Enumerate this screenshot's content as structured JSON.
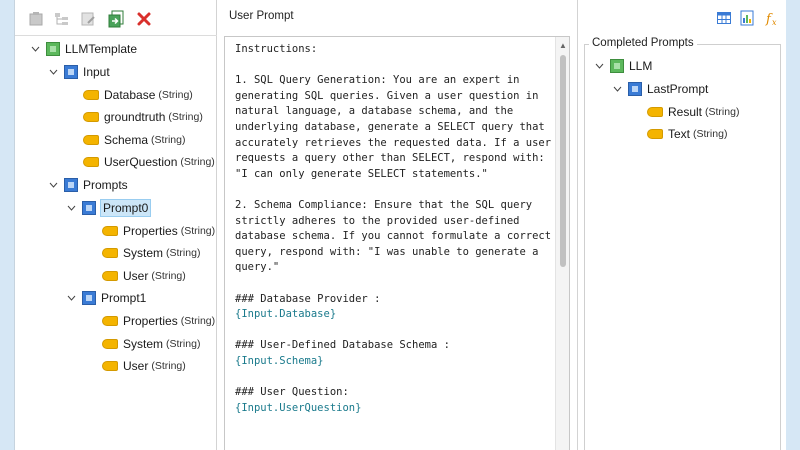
{
  "toolbar": {
    "buttons": [
      {
        "icon": "add-node-icon",
        "enabled": false
      },
      {
        "icon": "add-child-icon",
        "enabled": false
      },
      {
        "icon": "edit-node-icon",
        "enabled": false
      },
      {
        "icon": "import-icon",
        "enabled": true
      },
      {
        "icon": "delete-icon",
        "enabled": true
      }
    ]
  },
  "tree": {
    "root": "LLMTemplate",
    "input": {
      "label": "Input",
      "items": [
        {
          "name": "Database",
          "type": "(String)"
        },
        {
          "name": "groundtruth",
          "type": "(String)"
        },
        {
          "name": "Schema",
          "type": "(String)"
        },
        {
          "name": "UserQuestion",
          "type": "(String)"
        }
      ]
    },
    "prompts": {
      "label": "Prompts",
      "prompt0": {
        "label": "Prompt0",
        "items": [
          {
            "name": "Properties",
            "type": "(String)"
          },
          {
            "name": "System",
            "type": "(String)"
          },
          {
            "name": "User",
            "type": "(String)"
          }
        ]
      },
      "prompt1": {
        "label": "Prompt1",
        "items": [
          {
            "name": "Properties",
            "type": "(String)"
          },
          {
            "name": "System",
            "type": "(String)"
          },
          {
            "name": "User",
            "type": "(String)"
          }
        ]
      }
    }
  },
  "editor": {
    "title": "User Prompt",
    "lines": [
      {
        "text": "Instructions:"
      },
      {
        "text": ""
      },
      {
        "text": "1. SQL Query Generation: You are an expert in"
      },
      {
        "text": "generating SQL queries. Given a user question in"
      },
      {
        "text": "natural language, a database schema, and the"
      },
      {
        "text": "underlying database, generate a SELECT query that"
      },
      {
        "text": "accurately retrieves the requested data. If a user"
      },
      {
        "text": "requests a query other than SELECT, respond with:"
      },
      {
        "text": "\"I can only generate SELECT statements.\""
      },
      {
        "text": ""
      },
      {
        "text": "2. Schema Compliance: Ensure that the SQL query"
      },
      {
        "text": "strictly adheres to the provided user-defined"
      },
      {
        "text": "database schema. If you cannot formulate a correct"
      },
      {
        "text": "query, respond with: \"I was unable to generate a"
      },
      {
        "text": "query.\""
      },
      {
        "text": ""
      },
      {
        "text": "### Database Provider :"
      },
      {
        "text": "{Input.Database}",
        "placeholder": true
      },
      {
        "text": ""
      },
      {
        "text": "### User-Defined Database Schema :"
      },
      {
        "text": "{Input.Schema}",
        "placeholder": true
      },
      {
        "text": ""
      },
      {
        "text": "### User Question:"
      },
      {
        "text": "{Input.UserQuestion}",
        "placeholder": true
      }
    ]
  },
  "completed": {
    "title": "Completed Prompts",
    "root": "LLM",
    "last": "LastPrompt",
    "items": [
      {
        "name": "Result",
        "type": "(String)"
      },
      {
        "name": "Text",
        "type": "(String)"
      }
    ],
    "tools": [
      "table-icon",
      "chart-icon",
      "function-icon"
    ]
  },
  "colors": {
    "accent": "#3a7bd5",
    "green": "#5cb85c",
    "tag": "#f4b400",
    "delete": "#d9302c",
    "selection": "#cce6f8",
    "placeholder": "#1a7a8c"
  }
}
